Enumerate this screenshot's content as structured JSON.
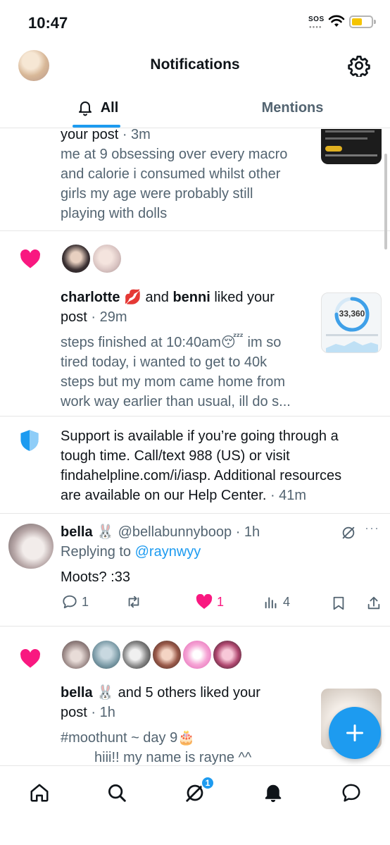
{
  "status_bar": {
    "time": "10:47",
    "sos": "SOS"
  },
  "header": {
    "title": "Notifications"
  },
  "tabs": [
    {
      "label": "All",
      "active": true
    },
    {
      "label": "Mentions",
      "active": false
    }
  ],
  "feed": {
    "item1": {
      "action_tail": "your post",
      "time": "· 3m",
      "lines": [
        "me at 9 obsessing over every macro",
        "and calorie i consumed whilst other",
        "girls my age were probably still",
        "playing with dolls"
      ]
    },
    "item2": {
      "user1": "charlotte",
      "user1_emoji": "💋",
      "connector": "and",
      "user2": "benni",
      "action": "liked your",
      "action2": "post",
      "time": "· 29m",
      "lines": [
        "steps finished at 10:40am😴 im so",
        "tired today, i wanted to get to 40k",
        "steps but my mom came home from",
        "work way earlier than usual, ill do s..."
      ],
      "thumb_number": "33,360"
    },
    "support": {
      "lines": [
        "Support is available if you’re going through a",
        "tough time. Call/text 988 (US) or visit",
        "findahelpline.com/i/iasp. Additional resources",
        "are available on our Help Center."
      ],
      "time": "· 41m"
    },
    "reply": {
      "name": "bella 🐰",
      "handle": "@bellabunnyboop",
      "time": "· 1h",
      "replying_prefix": "Replying to",
      "replying_to": "@raynwyy",
      "text": "Moots? :33",
      "reply_count": "1",
      "like_count": "1",
      "view_count": "4"
    },
    "item4": {
      "user": "bella 🐰",
      "action": "and 5 others liked your",
      "action2": "post",
      "time": "· 1h",
      "line1": "#moothunt ~ day 9🎂",
      "line2": "hiii!! my name is rayne ^^"
    }
  },
  "bottom_nav": {
    "badge": "1"
  },
  "colors": {
    "accent": "#1d9bf0",
    "like": "#f91880",
    "text": "#0f1419",
    "muted": "#536471"
  }
}
